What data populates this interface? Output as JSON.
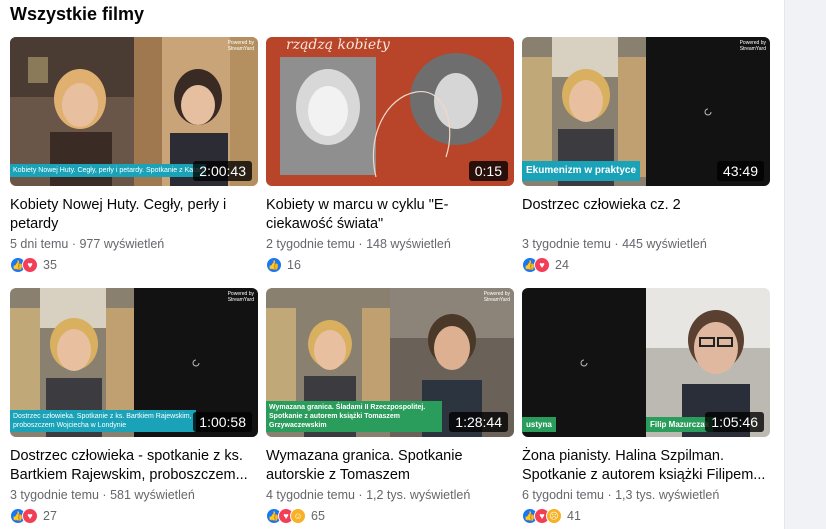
{
  "section": {
    "title": "Wszystkie filmy"
  },
  "overlay": {
    "powered": "Powered by",
    "streamyard": "StreamYard"
  },
  "videos": [
    {
      "title": "Kobiety Nowej Huty. Cegły, perły i petardy",
      "age": "5 dni temu",
      "views": "977 wyświetleń",
      "duration": "2:00:43",
      "reaction_count": "35",
      "reactions": [
        "like-icon",
        "love-icon"
      ],
      "tag": "Kobiety Nowej Huty. Cegły, perły i petardy. Spotkanie z Katarzyną..."
    },
    {
      "title": "Kobiety w marcu w cyklu \"E-ciekawość świata\"",
      "age": "2 tygodnie temu",
      "views": "148 wyświetleń",
      "duration": "0:15",
      "reaction_count": "16",
      "reactions": [
        "like-icon"
      ],
      "poster_text": "rządzą kobiety"
    },
    {
      "title": "Dostrzec człowieka cz. 2",
      "age": "3 tygodnie temu",
      "views": "445 wyświetleń",
      "duration": "43:49",
      "reaction_count": "24",
      "reactions": [
        "like-icon",
        "love-icon"
      ],
      "tag": "Ekumenizm w praktyce"
    },
    {
      "title": "Dostrzec człowieka - spotkanie z ks. Bartkiem Rajewskim, proboszczem...",
      "age": "3 tygodnie temu",
      "views": "581 wyświetleń",
      "duration": "1:00:58",
      "reaction_count": "27",
      "reactions": [
        "like-icon",
        "love-icon"
      ],
      "tag": "Dostrzec człowieka. Spotkanie z ks. Bartkiem Rajewskim, proboszczem Wojciecha w Londynie"
    },
    {
      "title": "Wymazana granica. Spotkanie autorskie z Tomaszem Grzywaczewskim, autore...",
      "age": "4 tygodnie temu",
      "views": "1,2 tys. wyświetleń",
      "duration": "1:28:44",
      "reaction_count": "65",
      "reactions": [
        "like-icon",
        "love-icon",
        "care-icon"
      ],
      "tag": "Wymazana granica. Śladami II Rzeczpospolitej. Spotkanie z autorem książki Tomaszem Grzywaczewskim"
    },
    {
      "title": "Żona pianisty. Halina Szpilman. Spotkanie z autorem książki Filipem...",
      "age": "6 tygodni temu",
      "views": "1,3 tys. wyświetleń",
      "duration": "1:05:46",
      "reaction_count": "41",
      "reactions": [
        "like-icon",
        "love-icon",
        "sad-icon"
      ],
      "tag_left": "ustyna",
      "tag": "Filip Mazurczak"
    }
  ],
  "colors": {
    "accent": "#1877f2",
    "love": "#f33e58",
    "tag_teal": "#1aa3b8",
    "tag_green": "#2a9d5c",
    "poster_bg": "#b8452a"
  }
}
